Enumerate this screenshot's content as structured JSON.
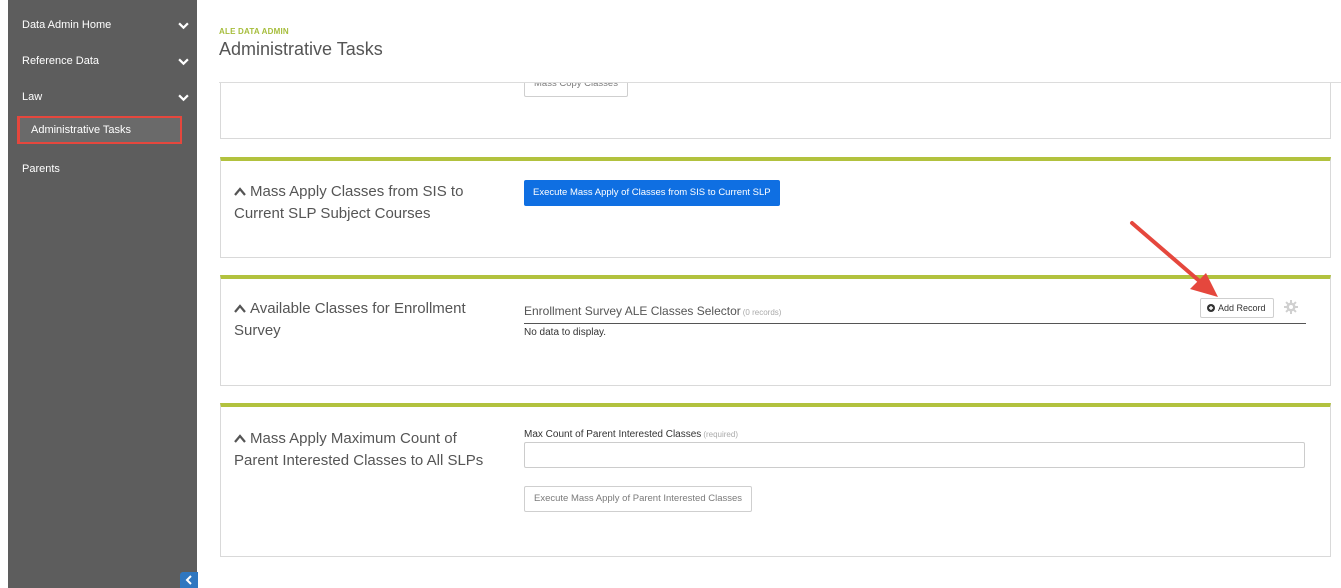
{
  "sidebar": {
    "items": [
      {
        "label": "Data Admin Home",
        "has_chevron": true
      },
      {
        "label": "Reference Data",
        "has_chevron": true
      },
      {
        "label": "Law",
        "has_chevron": true
      },
      {
        "label": "Administrative Tasks",
        "active": true
      },
      {
        "label": "Parents"
      }
    ],
    "collapse_icon": "chevron-left-icon"
  },
  "header": {
    "label": "ALE DATA ADMIN",
    "title": "Administrative Tasks"
  },
  "panels": {
    "mass_copy": {
      "button_label": "Mass Copy Classes"
    },
    "mass_apply_sis": {
      "title": "Mass Apply Classes from SIS to Current SLP Subject Courses",
      "button_label": "Execute Mass Apply of Classes from SIS to Current SLP"
    },
    "enrollment_survey": {
      "title": "Available Classes for Enrollment Survey",
      "selector_title": "Enrollment Survey ALE Classes Selector",
      "record_count": "(0 records)",
      "add_record_label": "Add Record",
      "empty_text": "No data to display."
    },
    "max_count": {
      "title": "Mass Apply Maximum Count of Parent Interested Classes to All SLPs",
      "field_label": "Max Count of Parent Interested Classes",
      "field_required": "(required)",
      "field_value": "",
      "button_label": "Execute Mass Apply of Parent Interested Classes"
    }
  },
  "colors": {
    "sidebar_bg": "#5d5d5d",
    "accent_green": "#b2c23e",
    "primary_blue": "#0f6fe2",
    "highlight_red": "#e5473d"
  }
}
